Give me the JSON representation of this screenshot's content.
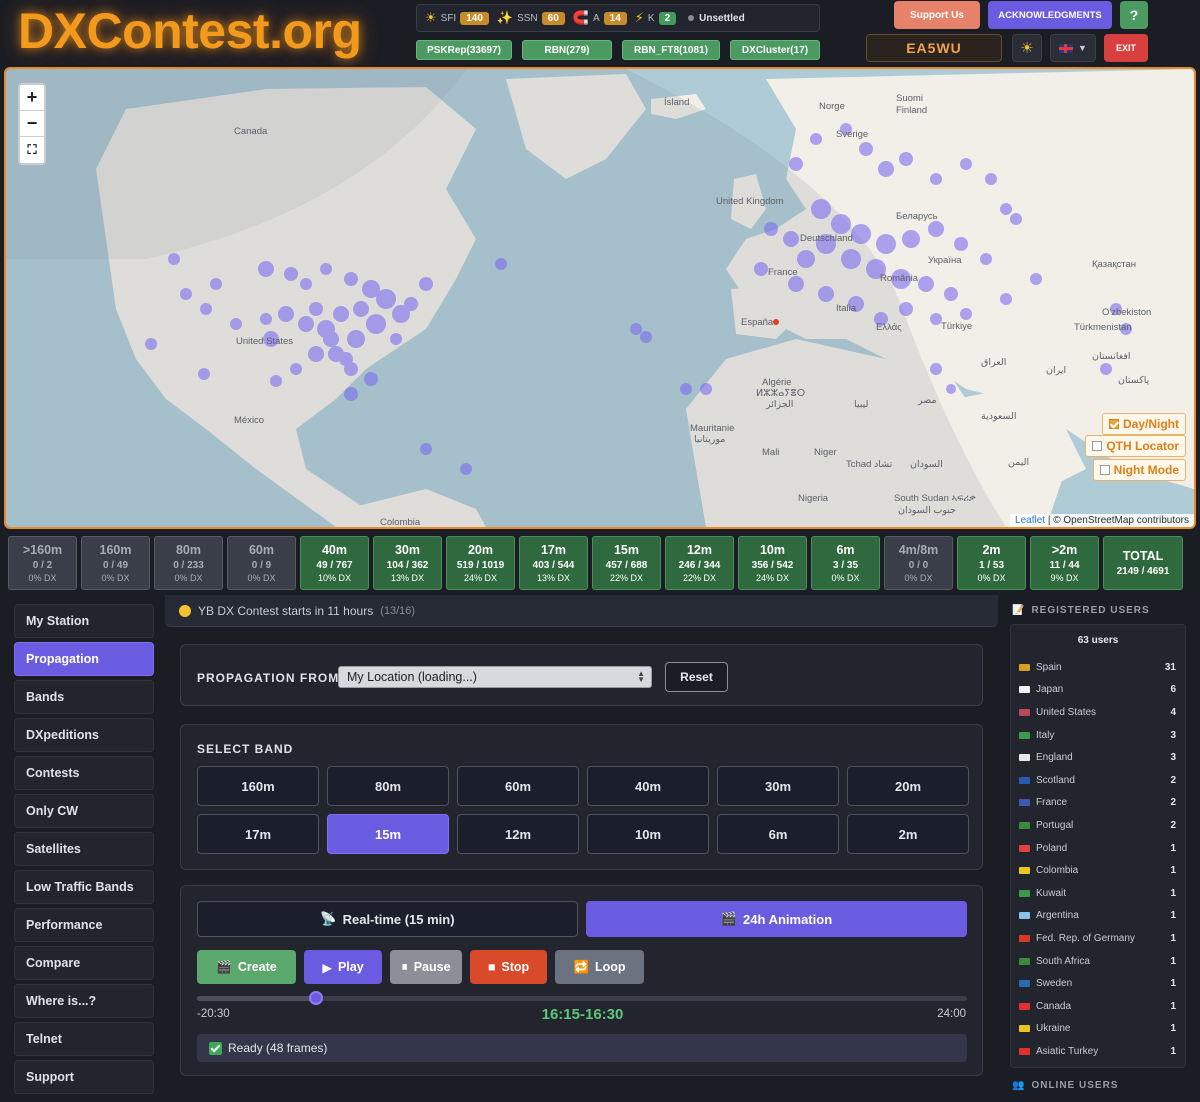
{
  "header": {
    "logo": "DXContest.org",
    "solar": {
      "sfi_label": "SFI",
      "sfi": "140",
      "ssn_label": "SSN",
      "ssn": "60",
      "a_label": "A",
      "a": "14",
      "k_label": "K",
      "k": "2",
      "status": "Unsettled"
    },
    "feeds": [
      "PSKRep(33697)",
      "RBN(279)",
      "RBN_FT8(1081)",
      "DXCluster(17)"
    ],
    "support": "Support Us",
    "acknowledgments": "ACKNOWLEDGMENTS",
    "help": "?",
    "callsign": "EA5WU",
    "exit": "EXIT"
  },
  "map": {
    "controls": {
      "day_night": "Day/Night",
      "qth_locator": "QTH Locator",
      "night_mode": "Night Mode"
    },
    "attribution_link": "Leaflet",
    "attribution_text": "| © OpenStreetMap contributors",
    "labels": [
      {
        "text": "Canada"
      },
      {
        "text": "United States"
      },
      {
        "text": "México"
      },
      {
        "text": "Colombia"
      },
      {
        "text": "Ísland"
      },
      {
        "text": "Norge"
      },
      {
        "text": "Sverige"
      },
      {
        "text": "Suomi"
      },
      {
        "text": "Finland"
      },
      {
        "text": "United Kingdom"
      },
      {
        "text": "Deutschland"
      },
      {
        "text": "France"
      },
      {
        "text": "España"
      },
      {
        "text": "Italia"
      },
      {
        "text": "Ελλάς"
      },
      {
        "text": "România"
      },
      {
        "text": "Україна"
      },
      {
        "text": "Беларусь"
      },
      {
        "text": "Türkiye"
      },
      {
        "text": "Қазақстан"
      },
      {
        "text": "O'zbekiston"
      },
      {
        "text": "Türkmenistan"
      },
      {
        "text": "العراق"
      },
      {
        "text": "ایران"
      },
      {
        "text": "افغانستان"
      },
      {
        "text": "پاکستان"
      },
      {
        "text": "Algérie"
      },
      {
        "text": "ⵍⵣⵣⴰⵢⴻⵔ"
      },
      {
        "text": "الجزائر"
      },
      {
        "text": "ليبيا"
      },
      {
        "text": "مصر"
      },
      {
        "text": "Mauritanie"
      },
      {
        "text": "موريتانيا"
      },
      {
        "text": "Mali"
      },
      {
        "text": "Niger"
      },
      {
        "text": "Tchad تشاد"
      },
      {
        "text": "السودان"
      },
      {
        "text": "Nigeria"
      },
      {
        "text": "South Sudan ኣፍሪቃ"
      },
      {
        "text": "جنوب السودان"
      },
      {
        "text": "السعودية"
      },
      {
        "text": "اليمن"
      }
    ]
  },
  "bands": [
    {
      "name": ">160m",
      "count": "0 / 2",
      "dx": "0% DX",
      "active": false
    },
    {
      "name": "160m",
      "count": "0 / 49",
      "dx": "0% DX",
      "active": false
    },
    {
      "name": "80m",
      "count": "0 / 233",
      "dx": "0% DX",
      "active": false
    },
    {
      "name": "60m",
      "count": "0 / 9",
      "dx": "0% DX",
      "active": false
    },
    {
      "name": "40m",
      "count": "49 / 767",
      "dx": "10% DX",
      "active": true
    },
    {
      "name": "30m",
      "count": "104 / 362",
      "dx": "13% DX",
      "active": true
    },
    {
      "name": "20m",
      "count": "519 / 1019",
      "dx": "24% DX",
      "active": true
    },
    {
      "name": "17m",
      "count": "403 / 544",
      "dx": "13% DX",
      "active": true
    },
    {
      "name": "15m",
      "count": "457 / 688",
      "dx": "22% DX",
      "active": true
    },
    {
      "name": "12m",
      "count": "246 / 344",
      "dx": "22% DX",
      "active": true
    },
    {
      "name": "10m",
      "count": "356 / 542",
      "dx": "24% DX",
      "active": true
    },
    {
      "name": "6m",
      "count": "3 / 35",
      "dx": "0% DX",
      "active": true
    },
    {
      "name": "4m/8m",
      "count": "0 / 0",
      "dx": "0% DX",
      "active": false
    },
    {
      "name": "2m",
      "count": "1 / 53",
      "dx": "0% DX",
      "active": true
    },
    {
      "name": ">2m",
      "count": "11 / 44",
      "dx": "9% DX",
      "active": true
    }
  ],
  "total": {
    "name": "TOTAL",
    "count": "2149 / 4691"
  },
  "sidebar": [
    "My Station",
    "Propagation",
    "Bands",
    "DXpeditions",
    "Contests",
    "Only CW",
    "Satellites",
    "Low Traffic Bands",
    "Performance",
    "Compare",
    "Where is...?",
    "Telnet",
    "Support"
  ],
  "sidebar_active": "Propagation",
  "banner": {
    "text": "YB DX Contest starts in 11 hours",
    "fraction": "(13/16)"
  },
  "propagation": {
    "from_label": "PROPAGATION FROM",
    "select_value": "My Location (loading...)",
    "reset": "Reset"
  },
  "select_band": {
    "label": "SELECT BAND",
    "bands": [
      "160m",
      "80m",
      "60m",
      "40m",
      "30m",
      "20m",
      "17m",
      "15m",
      "12m",
      "10m",
      "6m",
      "2m"
    ],
    "selected": "15m"
  },
  "animation": {
    "realtime": "Real-time (15 min)",
    "anim24": "24h Animation",
    "create": "Create",
    "play": "Play",
    "pause": "Pause",
    "stop": "Stop",
    "loop": "Loop",
    "start": "-20:30",
    "end": "24:00",
    "current": "16:15-16:30",
    "progress": 0.155,
    "status": "Ready (48 frames)"
  },
  "registered": {
    "title": "REGISTERED USERS",
    "count": "63 users",
    "users": [
      {
        "country": "Spain",
        "n": "31",
        "flag": "#d8a020"
      },
      {
        "country": "Japan",
        "n": "6",
        "flag": "#f2f2f2"
      },
      {
        "country": "United States",
        "n": "4",
        "flag": "#b8485a"
      },
      {
        "country": "Italy",
        "n": "3",
        "flag": "#3a9a4a"
      },
      {
        "country": "England",
        "n": "3",
        "flag": "#e8e8e8"
      },
      {
        "country": "Scotland",
        "n": "2",
        "flag": "#2a5ab0"
      },
      {
        "country": "France",
        "n": "2",
        "flag": "#3a5ab0"
      },
      {
        "country": "Portugal",
        "n": "2",
        "flag": "#3a8a3a"
      },
      {
        "country": "Poland",
        "n": "1",
        "flag": "#e04040"
      },
      {
        "country": "Colombia",
        "n": "1",
        "flag": "#e8c820"
      },
      {
        "country": "Kuwait",
        "n": "1",
        "flag": "#3a9a4a"
      },
      {
        "country": "Argentina",
        "n": "1",
        "flag": "#8ac0e8"
      },
      {
        "country": "Fed. Rep. of Germany",
        "n": "1",
        "flag": "#d83a20"
      },
      {
        "country": "South Africa",
        "n": "1",
        "flag": "#3a8a3a"
      },
      {
        "country": "Sweden",
        "n": "1",
        "flag": "#2a6ab0"
      },
      {
        "country": "Canada",
        "n": "1",
        "flag": "#e03030"
      },
      {
        "country": "Ukraine",
        "n": "1",
        "flag": "#e8c820"
      },
      {
        "country": "Asiatic Turkey",
        "n": "1",
        "flag": "#e03030"
      }
    ]
  },
  "online": {
    "title": "ONLINE USERS"
  },
  "colors": {
    "accent": "#6a5ce0",
    "logo": "#f39a1c",
    "band_active": "#2f6a3e",
    "spot": "#7b6cf0"
  }
}
